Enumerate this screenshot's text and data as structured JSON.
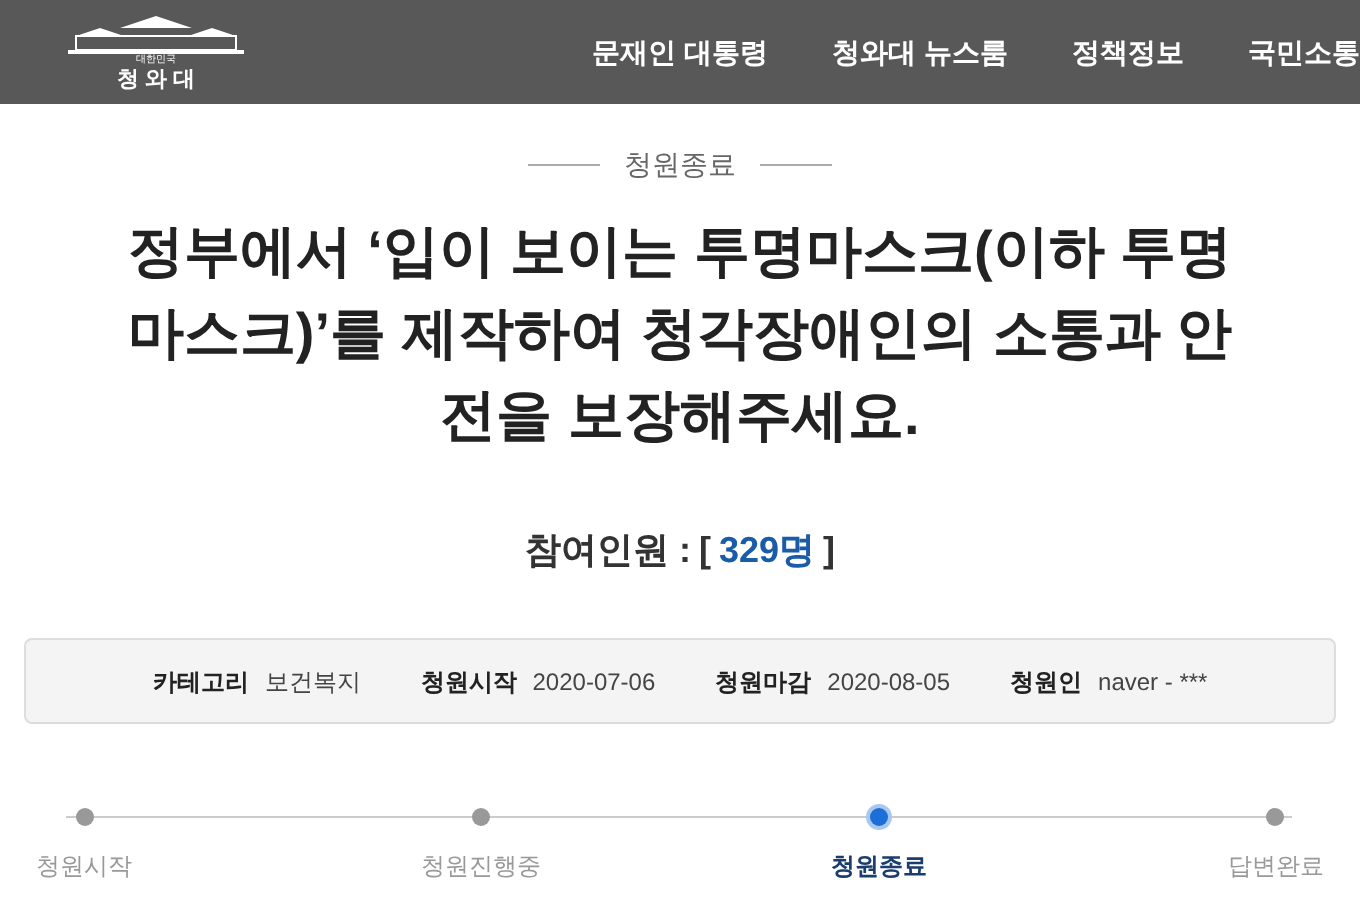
{
  "header": {
    "logo": {
      "small_text": "대한민국",
      "name": "청 와 대"
    },
    "nav": [
      "문재인 대통령",
      "청와대 뉴스룸",
      "정책정보",
      "국민소통"
    ]
  },
  "status": "청원종료",
  "title": "정부에서 ‘입이 보이는 투명마스크(이하 투명마스크)’를 제작하여 청각장애인의 소통과 안전을 보장해주세요.",
  "participants": {
    "label": "참여인원 :",
    "open": "[",
    "count": "329명",
    "close": "]"
  },
  "info": [
    {
      "label": "카테고리",
      "value": "보건복지"
    },
    {
      "label": "청원시작",
      "value": "2020-07-06"
    },
    {
      "label": "청원마감",
      "value": "2020-08-05"
    },
    {
      "label": "청원인",
      "value": "naver - ***"
    }
  ],
  "steps": [
    {
      "label": "청원시작",
      "selected": false
    },
    {
      "label": "청원진행중",
      "selected": false
    },
    {
      "label": "청원종료",
      "selected": true
    },
    {
      "label": "답변완료",
      "selected": false
    }
  ]
}
